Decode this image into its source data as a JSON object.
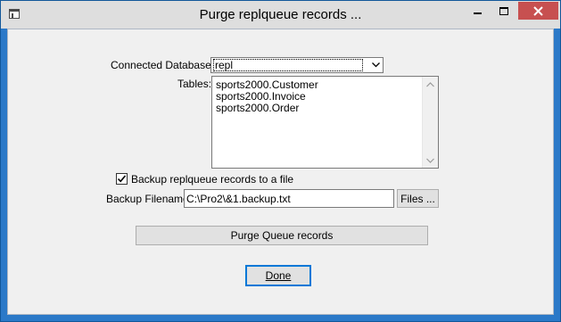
{
  "window": {
    "title": "Purge replqueue records ...",
    "controls": [
      "minimize-icon",
      "maximize-icon",
      "close-icon"
    ]
  },
  "connected_databases": {
    "label": "Connected Databases:",
    "selected": "repl"
  },
  "tables": {
    "label": "Tables:",
    "items": [
      "sports2000.Customer",
      "sports2000.Invoice",
      "sports2000.Order"
    ]
  },
  "backup": {
    "checkbox_label": "Backup replqueue records to a file",
    "checked": true,
    "filename_label": "Backup Filename:",
    "filename_value": "C:\\Pro2\\&1.backup.txt",
    "files_button": "Files ..."
  },
  "purge_button": "Purge Queue records",
  "done_button": "Done"
}
